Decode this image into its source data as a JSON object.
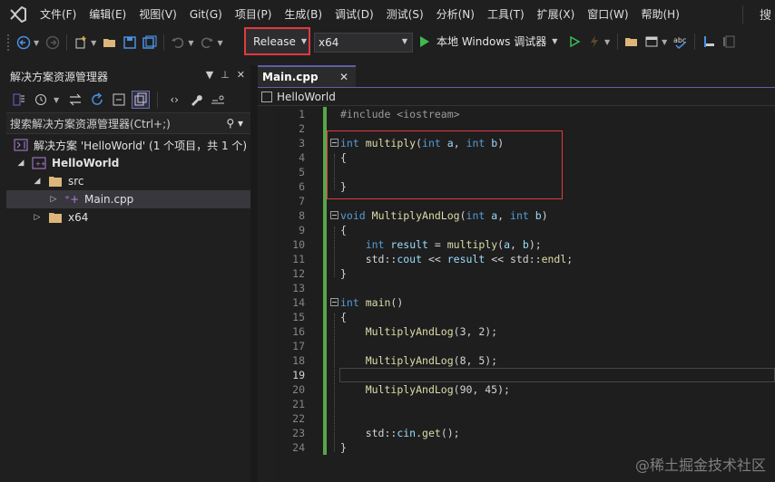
{
  "menu": {
    "items": [
      "文件(F)",
      "编辑(E)",
      "视图(V)",
      "Git(G)",
      "项目(P)",
      "生成(B)",
      "调试(D)",
      "测试(S)",
      "分析(N)",
      "工具(T)",
      "扩展(X)",
      "窗口(W)",
      "帮助(H)"
    ],
    "search_glyph": "搜"
  },
  "toolbar": {
    "configuration": "Release",
    "platform": "x64",
    "run_label": "本地 Windows 调试器"
  },
  "solution_explorer": {
    "title": "解决方案资源管理器",
    "search_placeholder": "搜索解决方案资源管理器(Ctrl+;)",
    "solution_label": "解决方案 'HelloWorld' (1 个项目，共 1 个)",
    "project": "HelloWorld",
    "folder_src": "src",
    "file_main": "Main.cpp",
    "folder_x64": "x64"
  },
  "editor": {
    "tab_label": "Main.cpp",
    "nav_project": "HelloWorld",
    "current_line": 19,
    "lines": [
      {
        "n": "1",
        "html": "<span class=\"pp\">#include &lt;iostream&gt;</span>"
      },
      {
        "n": "2",
        "html": ""
      },
      {
        "n": "3",
        "html": "<span class=\"kw\">int</span> <span class=\"fn\">multiply</span>(<span class=\"kw\">int</span> <span class=\"vr\">a</span>, <span class=\"kw\">int</span> <span class=\"vr\">b</span>)"
      },
      {
        "n": "4",
        "html": "{"
      },
      {
        "n": "5",
        "html": ""
      },
      {
        "n": "6",
        "html": "}"
      },
      {
        "n": "7",
        "html": ""
      },
      {
        "n": "8",
        "html": "<span class=\"kw\">void</span> <span class=\"fn\">MultiplyAndLog</span>(<span class=\"kw\">int</span> <span class=\"vr\">a</span>, <span class=\"kw\">int</span> <span class=\"vr\">b</span>)"
      },
      {
        "n": "9",
        "html": "{"
      },
      {
        "n": "10",
        "html": "    <span class=\"kw\">int</span> <span class=\"vr\">result</span> = <span class=\"fn\">multiply</span>(<span class=\"vr\">a</span>, <span class=\"vr\">b</span>);"
      },
      {
        "n": "11",
        "html": "    std::<span class=\"vr\">cout</span> &lt;&lt; <span class=\"vr\">result</span> &lt;&lt; std::<span class=\"fn\">endl</span>;"
      },
      {
        "n": "12",
        "html": "}"
      },
      {
        "n": "13",
        "html": ""
      },
      {
        "n": "14",
        "html": "<span class=\"kw\">int</span> <span class=\"fn\">main</span>()"
      },
      {
        "n": "15",
        "html": "{"
      },
      {
        "n": "16",
        "html": "    <span class=\"fn\">MultiplyAndLog</span>(3, 2);"
      },
      {
        "n": "17",
        "html": ""
      },
      {
        "n": "18",
        "html": "    <span class=\"fn\">MultiplyAndLog</span>(8, 5);"
      },
      {
        "n": "19",
        "html": ""
      },
      {
        "n": "20",
        "html": "    <span class=\"fn\">MultiplyAndLog</span>(90, 45);"
      },
      {
        "n": "21",
        "html": ""
      },
      {
        "n": "22",
        "html": ""
      },
      {
        "n": "23",
        "html": "    std::<span class=\"vr\">cin</span>.<span class=\"fn\">get</span>();"
      },
      {
        "n": "24",
        "html": "}"
      }
    ]
  },
  "watermark": "@稀土掘金技术社区",
  "colors": {
    "accent": "#5e5ea8",
    "highlight_box": "#e0393e",
    "change_bar": "#57a64a",
    "keyword": "#569cd6",
    "function": "#dcdcaa"
  }
}
